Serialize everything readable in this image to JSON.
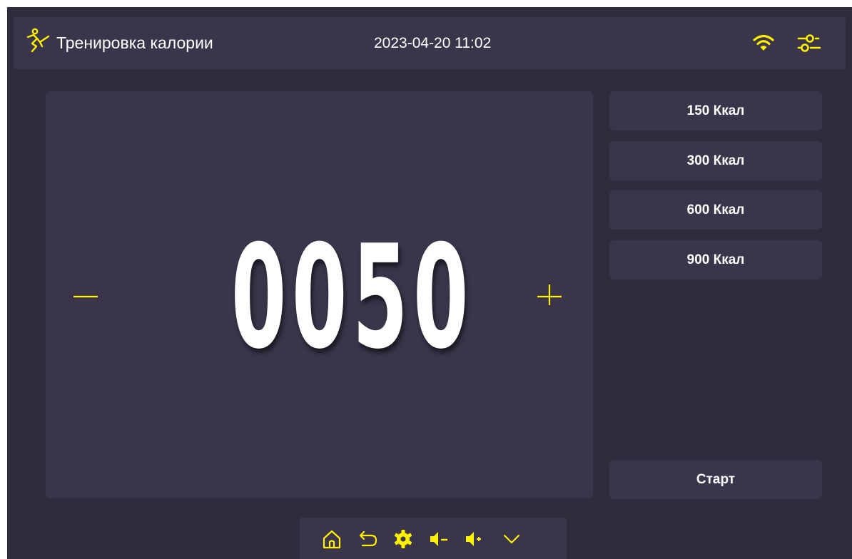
{
  "header": {
    "title": "Тренировка калории",
    "datetime": "2023-04-20 11:02",
    "icons": [
      "run-icon",
      "wifi-icon",
      "settings-sliders-icon"
    ]
  },
  "main": {
    "value": "0050",
    "minus_icon": "minus-icon",
    "plus_icon": "plus-icon"
  },
  "presets": [
    {
      "label": "150 Ккал"
    },
    {
      "label": "300 Ккал"
    },
    {
      "label": "600 Ккал"
    },
    {
      "label": "900 Ккал"
    }
  ],
  "start_label": "Старт",
  "toolbar": {
    "icons": [
      "home-icon",
      "back-icon",
      "gear-icon",
      "volume-down-icon",
      "volume-up-icon",
      "chevron-down-icon"
    ]
  },
  "colors": {
    "accent": "#fff200",
    "background": "#302b3d",
    "panel": "#3a354a",
    "text": "#ffffff"
  }
}
